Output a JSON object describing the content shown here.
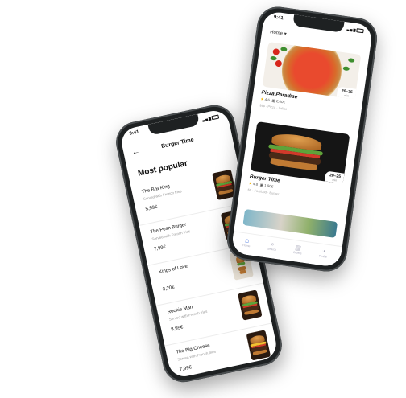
{
  "left_phone": {
    "status_time": "9:41",
    "back_glyph": "←",
    "title": "Burger Time",
    "section": "Most popular",
    "items": [
      {
        "name": "The B.B King",
        "desc": "Served with French fries",
        "price": "5,99€"
      },
      {
        "name": "The Posh Burger",
        "desc": "Served with French fries",
        "price": "7,99€"
      },
      {
        "name": "Kings of Love",
        "desc": "",
        "price": "3,20€"
      },
      {
        "name": "Rookie Man",
        "desc": "Served with French fries",
        "price": "8,95€"
      },
      {
        "name": "The Big Cheese",
        "desc": "Served with French fries",
        "price": "7,99€"
      }
    ]
  },
  "right_phone": {
    "status_time": "9:41",
    "location": "Home ▾",
    "restaurants": [
      {
        "name": "Pizza Paradise",
        "rating": "4.6",
        "fee": "2,00€",
        "tags": "$$$ · Pizza · Italian",
        "eta": "20–35",
        "eta_unit": "min"
      },
      {
        "name": "Burger Time",
        "rating": "4.8",
        "fee": "1,90€",
        "tags": "$$ · Fastfood · Burger",
        "eta": "20–25",
        "eta_unit": "min"
      }
    ],
    "tabs": [
      {
        "icon": "home-icon",
        "glyph": "⌂",
        "label": "Home"
      },
      {
        "icon": "search-icon",
        "glyph": "⌕",
        "label": "Search"
      },
      {
        "icon": "orders-icon",
        "glyph": "▤",
        "label": "Orders"
      },
      {
        "icon": "profile-icon",
        "glyph": "◔",
        "label": "Profile"
      }
    ]
  },
  "colors": {
    "accent": "#2b5fd9",
    "star": "#f5b400",
    "phone_frame": "#1e2122"
  }
}
